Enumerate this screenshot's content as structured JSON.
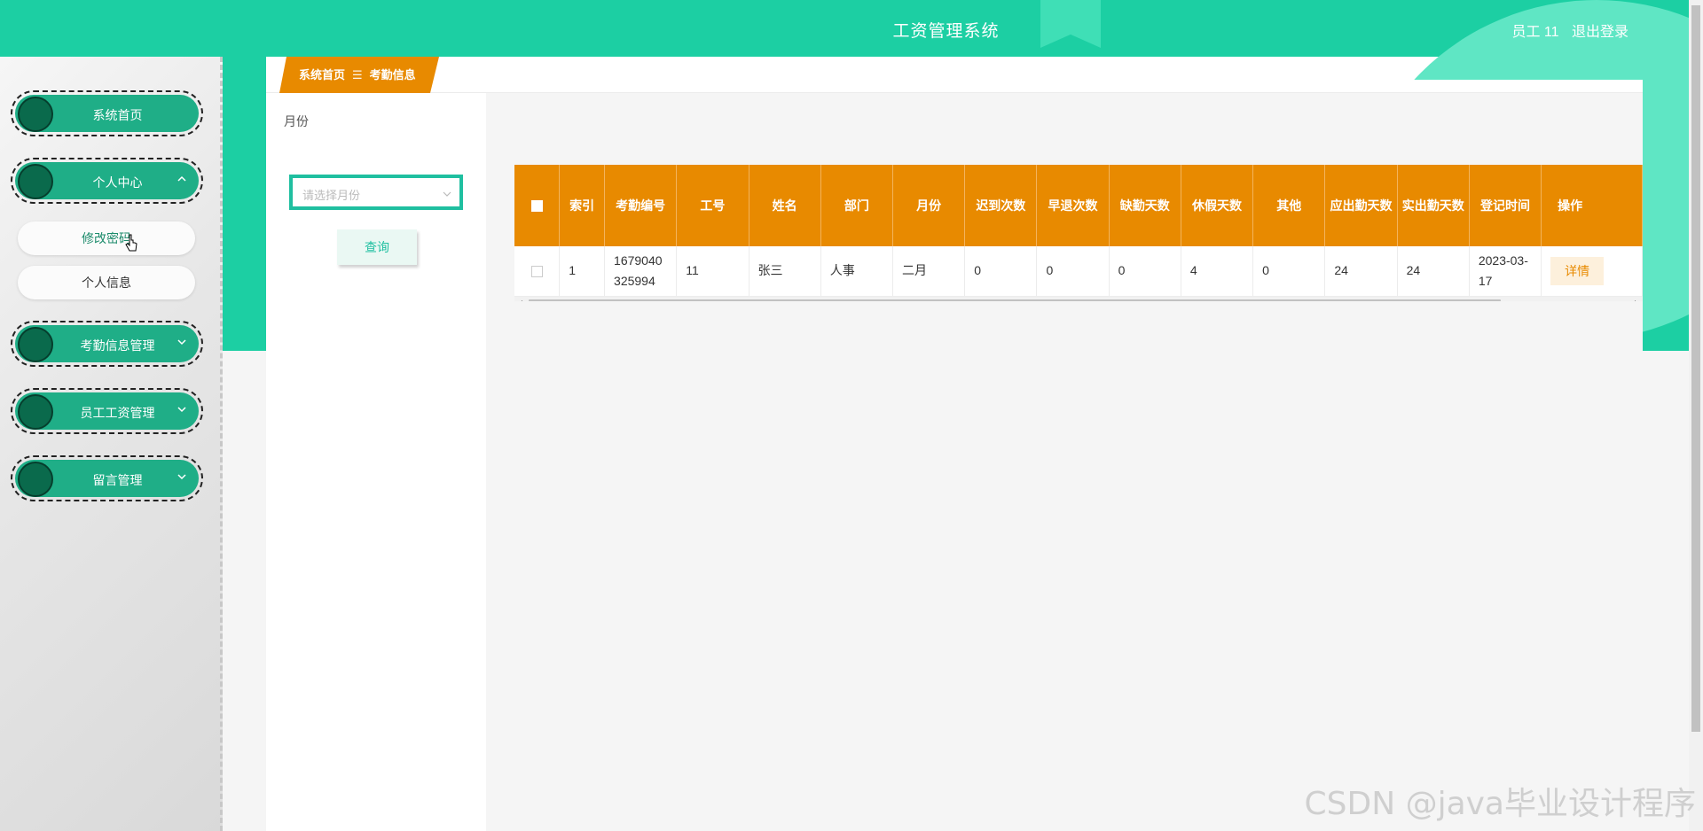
{
  "header": {
    "title": "工资管理系统",
    "user_label": "员工 11",
    "logout_label": "退出登录"
  },
  "sidebar": {
    "items": [
      {
        "label": "系统首页",
        "has_chevron": false
      },
      {
        "label": "个人中心",
        "expanded": true
      },
      {
        "label": "考勤信息管理",
        "expanded": false
      },
      {
        "label": "员工工资管理",
        "expanded": false
      },
      {
        "label": "留言管理",
        "expanded": false
      }
    ],
    "sub_items": [
      {
        "label": "修改密码",
        "active": true
      },
      {
        "label": "个人信息",
        "active": false
      }
    ]
  },
  "breadcrumb": {
    "home": "系统首页",
    "separator": "☰",
    "current": "考勤信息"
  },
  "filter": {
    "month_label": "月份",
    "month_placeholder": "请选择月份",
    "query_label": "查询"
  },
  "table": {
    "headers": [
      "索引",
      "考勤编号",
      "工号",
      "姓名",
      "部门",
      "月份",
      "迟到次数",
      "早退次数",
      "缺勤天数",
      "休假天数",
      "其他",
      "应出勤天数",
      "实出勤天数",
      "登记时间",
      "操作"
    ],
    "rows": [
      {
        "index": "1",
        "attendance_no": "1679040325994",
        "employee_no": "11",
        "name": "张三",
        "department": "人事",
        "month": "二月",
        "late_count": "0",
        "early_leave_count": "0",
        "absent_days": "0",
        "leave_days": "4",
        "other": "0",
        "required_days": "24",
        "actual_days": "24",
        "register_time": "2023-03-17",
        "action_label": "详情"
      }
    ]
  },
  "watermark": "CSDN @java毕业设计程序",
  "colors": {
    "primary_green": "#1ccfa3",
    "menu_green": "#1fae87",
    "accent_orange": "#e88a00"
  }
}
